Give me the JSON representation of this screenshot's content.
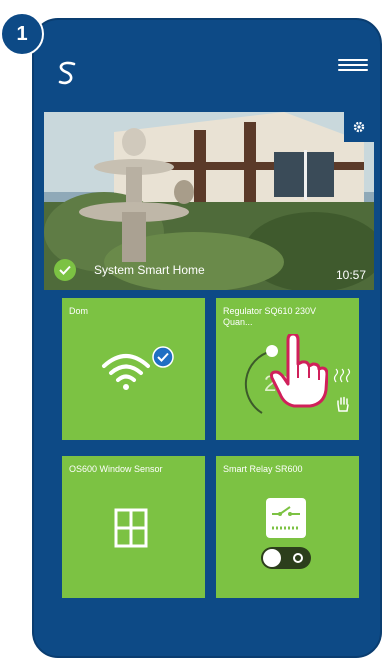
{
  "step": {
    "number": "1"
  },
  "header": {
    "logo_icon": "salus-logo-icon",
    "menu_icon": "hamburger-menu-icon"
  },
  "hero": {
    "title": "System Smart Home",
    "time": "10:57",
    "status_icon": "check-icon",
    "settings_icon": "gear-icon"
  },
  "tiles": [
    {
      "label": "Dom",
      "icon": "wifi-icon",
      "badge_icon": "check-icon"
    },
    {
      "label": "Regulator SQ610 230V Quan...",
      "temperature": "23.",
      "icons": [
        "heat-waves-icon",
        "hand-icon",
        "pointer-hand-icon"
      ]
    },
    {
      "label": "OS600 Window Sensor",
      "icon": "window-icon"
    },
    {
      "label": "Smart Relay SR600",
      "icon": "relay-switch-icon",
      "toggle_icon": "toggle-icon"
    }
  ],
  "colors": {
    "background": "#0d4a86",
    "tile": "#7cc243",
    "text": "#ffffff"
  }
}
